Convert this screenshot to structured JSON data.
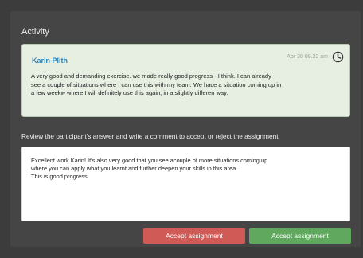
{
  "activity": {
    "title": "Activity",
    "card": {
      "author": "Karin Plith",
      "timestamp": "Apr 30 09.22 am",
      "answer": "A very good and demanding exercise. we made really good progress - I think. I can already\nsee a couple of situations where I can use this with my team. We hace a situation coming up in\na few weekw where I will definitely use this again, in a slightly differen way."
    }
  },
  "review": {
    "instruction": "Review the participant's answer and write a comment to accept or reject the assignment",
    "comment": "Excellent work Karin! It's also very good that you see acouple of more situations coming up\nwhere you can apply what you learnt and further deepen your skills in this area.\nThis is good progress."
  },
  "buttons": {
    "reject_label": "Accept assignment",
    "accept_label": "Accept assignment"
  },
  "colors": {
    "reject": "#d05a55",
    "accept": "#5fa85d",
    "author": "#2f84b8"
  },
  "icons": {
    "timestamp_icon": "clock-icon"
  }
}
